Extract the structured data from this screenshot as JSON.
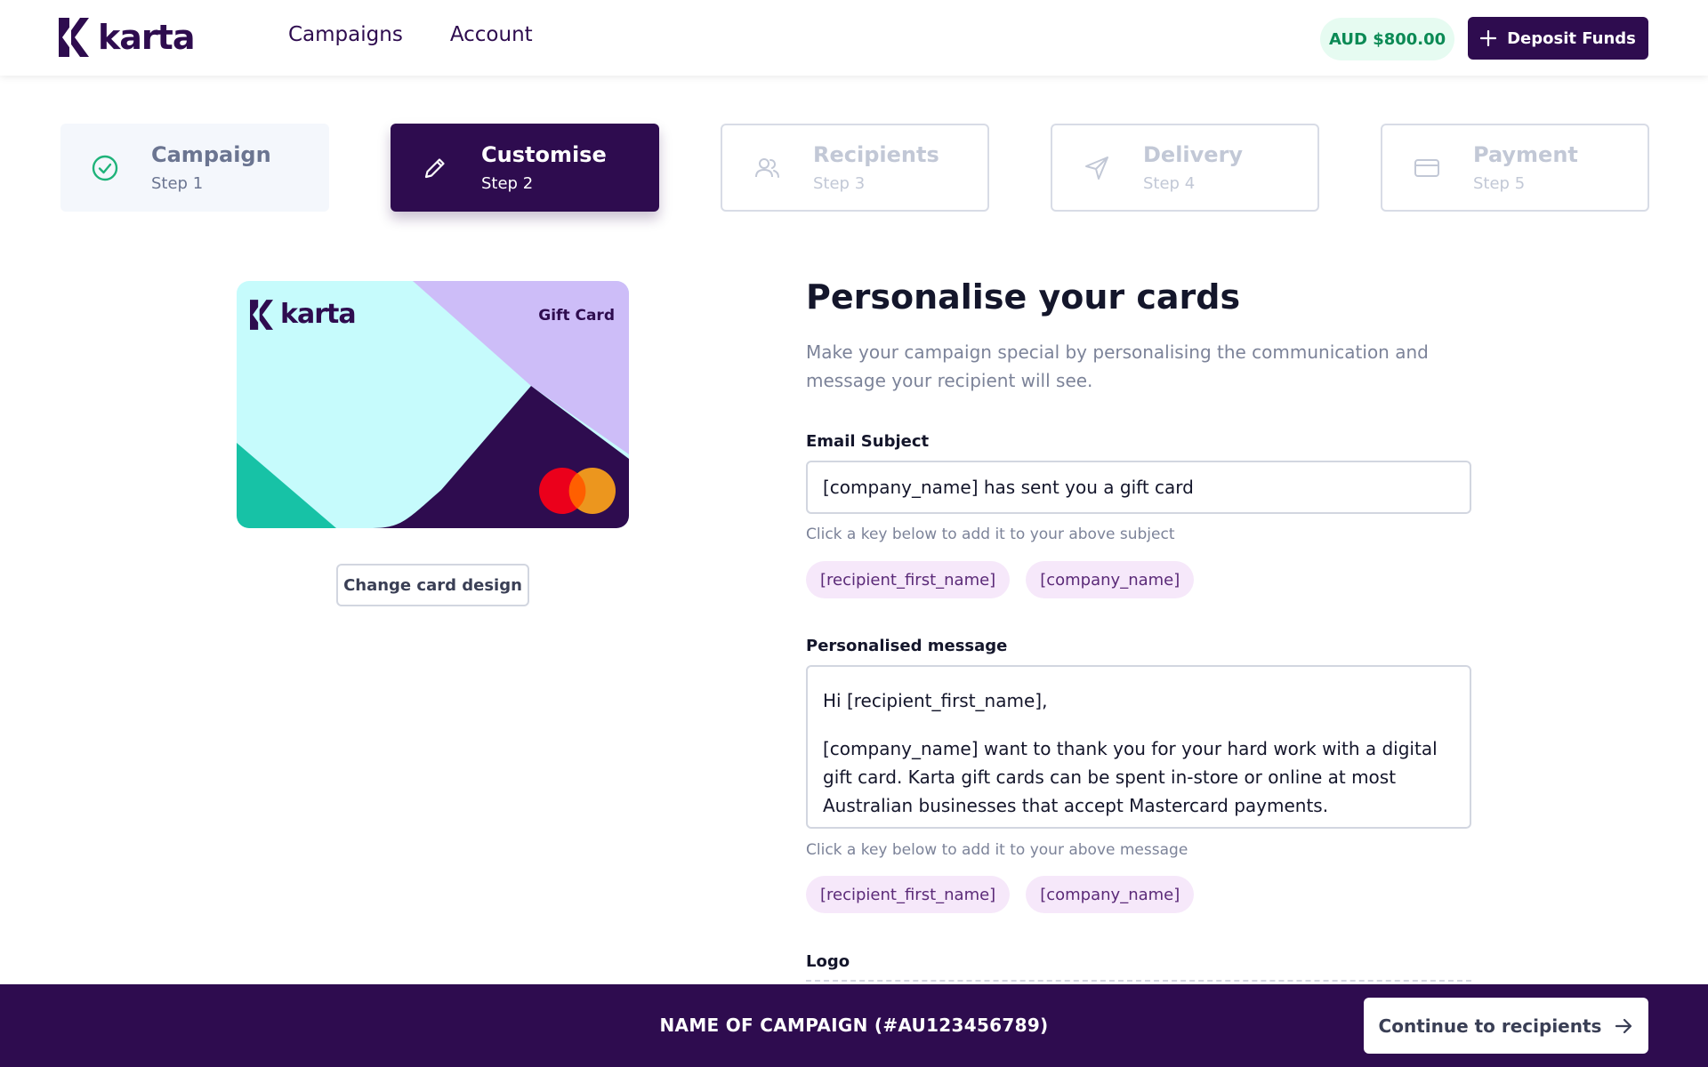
{
  "header": {
    "logo_text": "karta",
    "nav": [
      "Campaigns",
      "Account"
    ],
    "balance": "AUD $800.00",
    "deposit_label": "Deposit Funds"
  },
  "steps": [
    {
      "title": "Campaign",
      "sub": "Step 1",
      "state": "done",
      "icon": "check-circle-icon"
    },
    {
      "title": "Customise",
      "sub": "Step 2",
      "state": "active",
      "icon": "pencil-icon"
    },
    {
      "title": "Recipients",
      "sub": "Step 3",
      "state": "todo",
      "icon": "users-icon"
    },
    {
      "title": "Delivery",
      "sub": "Step 4",
      "state": "todo",
      "icon": "send-icon"
    },
    {
      "title": "Payment",
      "sub": "Step 5",
      "state": "todo",
      "icon": "credit-card-icon"
    }
  ],
  "card": {
    "brand": "karta",
    "label": "Gift Card",
    "change_label": "Change card design"
  },
  "form": {
    "heading": "Personalise your cards",
    "intro": "Make your campaign special by personalising the communication and message your recipient will see.",
    "subject_label": "Email Subject",
    "subject_value": "[company_name] has sent you a gift card",
    "subject_hint": "Click a key below to add it to your above subject",
    "keys": [
      "[recipient_first_name]",
      "[company_name]"
    ],
    "message_label": "Personalised message",
    "message_line1": "Hi [recipient_first_name],",
    "message_line2": "[company_name] want to thank you for your hard work with a digital gift card. Karta gift cards can be spent in-store or online at most Australian businesses that accept Mastercard payments.",
    "message_hint": "Click a key below to add it to your above message",
    "logo_label": "Logo"
  },
  "footer": {
    "campaign_name": "NAME OF CAMPAIGN (#AU123456789)",
    "continue_label": "Continue to recipients"
  },
  "colors": {
    "brand": "#2e0c4f",
    "success": "#1fb37a",
    "chip_bg": "#f6e8fa"
  }
}
